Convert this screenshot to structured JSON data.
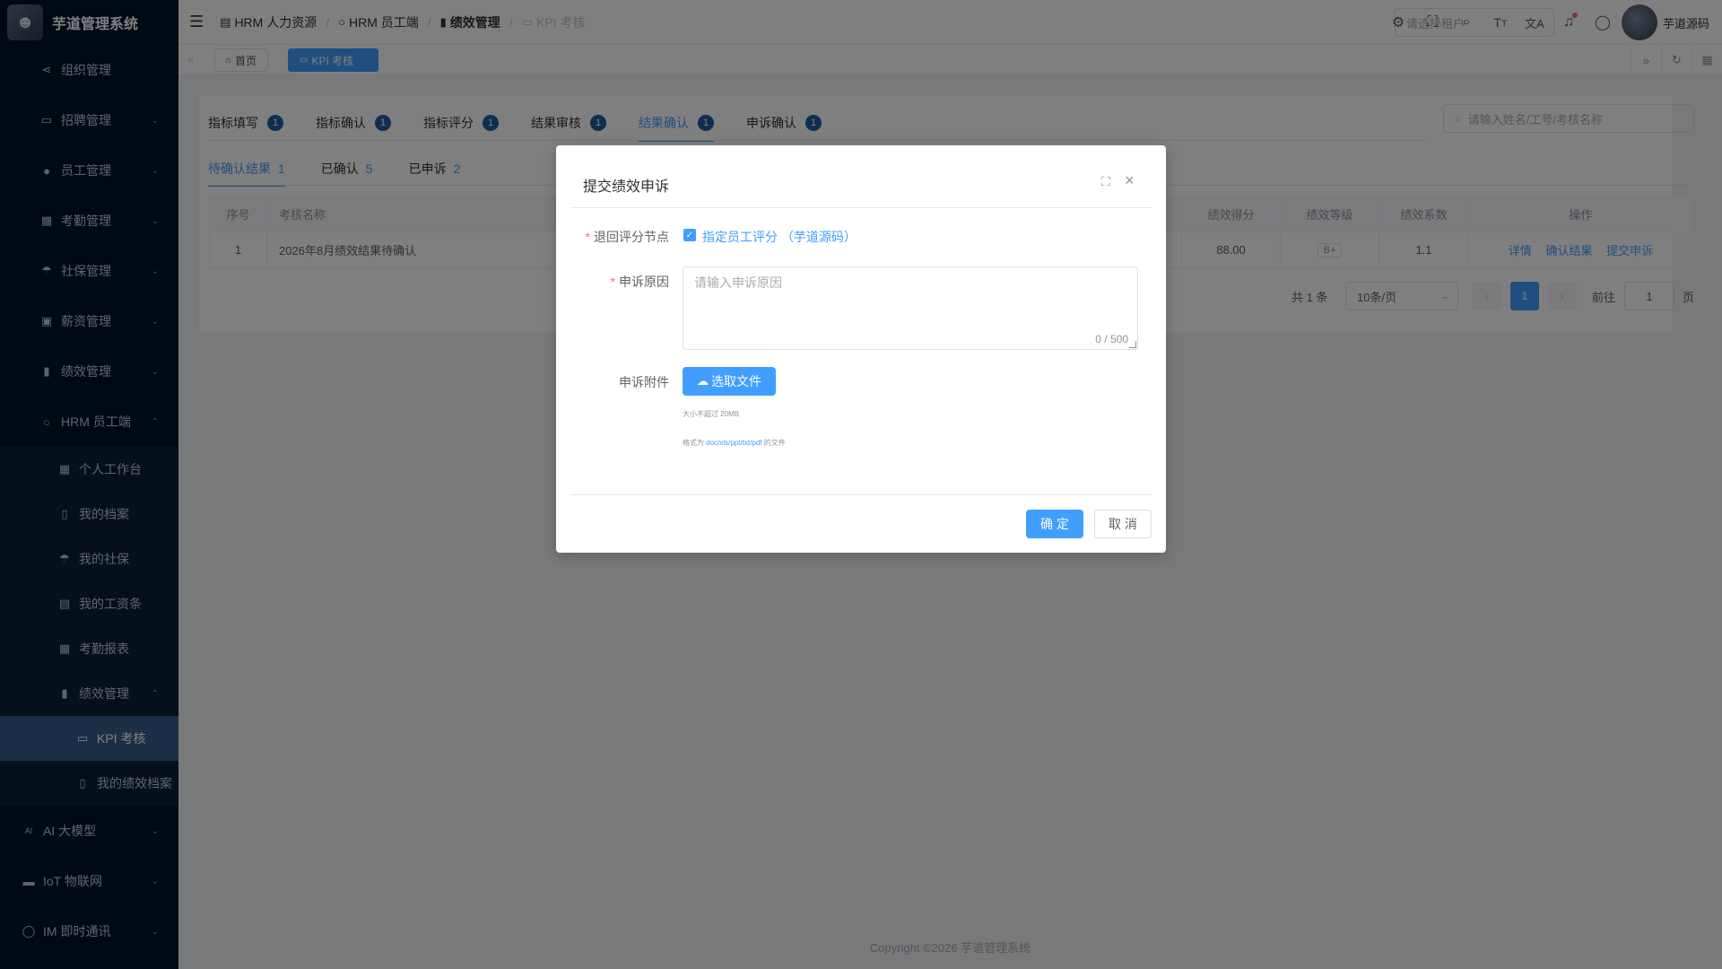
{
  "app": {
    "title": "芋道管理系统"
  },
  "sidebar": {
    "items": [
      {
        "label": "组织管理",
        "icon": "share-icon"
      },
      {
        "label": "招聘管理",
        "icon": "briefcase-icon"
      },
      {
        "label": "员工管理",
        "icon": "user-icon"
      },
      {
        "label": "考勤管理",
        "icon": "calendar-icon"
      },
      {
        "label": "社保管理",
        "icon": "umbrella-icon"
      },
      {
        "label": "薪资管理",
        "icon": "money-icon"
      },
      {
        "label": "绩效管理",
        "icon": "bar-chart-icon"
      },
      {
        "label": "HRM 员工端",
        "icon": "user-outline-icon"
      }
    ],
    "hrm_sub": [
      {
        "label": "个人工作台",
        "icon": "calendar-icon"
      },
      {
        "label": "我的档案",
        "icon": "book-icon"
      },
      {
        "label": "我的社保",
        "icon": "umbrella-icon"
      },
      {
        "label": "我的工资条",
        "icon": "document-icon"
      },
      {
        "label": "考勤报表",
        "icon": "calendar-icon"
      },
      {
        "label": "绩效管理",
        "icon": "bar-chart-icon"
      }
    ],
    "perf_sub": [
      {
        "label": "KPI 考核",
        "icon": "presentation-icon"
      },
      {
        "label": "我的绩效档案",
        "icon": "book-icon"
      }
    ],
    "bottom": [
      {
        "label": "AI 大模型",
        "icon": "ai-icon"
      },
      {
        "label": "IoT 物联网",
        "icon": "car-icon"
      },
      {
        "label": "IM 即时通讯",
        "icon": "chat-icon"
      }
    ]
  },
  "header": {
    "breadcrumb": [
      "HRM 人力资源",
      "HRM 员工端",
      "绩效管理",
      "KPI 考核"
    ],
    "tenant_placeholder": "请选择租户",
    "user_name": "芋道源码"
  },
  "tagsbar": {
    "tags": [
      "首页",
      "KPI 考核"
    ]
  },
  "tabs": [
    {
      "label": "指标填写",
      "badge": "1"
    },
    {
      "label": "指标确认",
      "badge": "1"
    },
    {
      "label": "指标评分",
      "badge": "1"
    },
    {
      "label": "结果审核",
      "badge": "1"
    },
    {
      "label": "结果确认",
      "badge": "1"
    },
    {
      "label": "申诉确认",
      "badge": "1"
    }
  ],
  "search": {
    "placeholder": "请输入姓名/工号/考核名称"
  },
  "subtabs": [
    {
      "label": "待确认结果",
      "count": "1"
    },
    {
      "label": "已确认",
      "count": "5"
    },
    {
      "label": "已申诉",
      "count": "2"
    }
  ],
  "table": {
    "headers": {
      "index": "序号",
      "name": "考核名称",
      "score": "绩效得分",
      "grade": "绩效等级",
      "coef": "绩效系数",
      "ops": "操作"
    },
    "rows": [
      {
        "index": "1",
        "name": "2026年8月绩效结果待确认",
        "score": "88.00",
        "grade": "B+",
        "coef": "1.1"
      }
    ],
    "ops": [
      "详情",
      "确认结果",
      "提交申诉"
    ]
  },
  "pager": {
    "total": "共 1 条",
    "page_size": "10条/页",
    "current": "1",
    "goto_label": "前往",
    "goto_value": "1",
    "page_suffix": "页"
  },
  "footer": "Copyright ©2026 芋道管理系统",
  "dialog": {
    "title": "提交绩效申诉",
    "node_label": "退回评分节点",
    "node_value": "指定员工评分 （芋道源码）",
    "reason_label": "申诉原因",
    "reason_placeholder": "请输入申诉原因",
    "reason_count": "0 / 500",
    "attach_label": "申诉附件",
    "upload_label": "选取文件",
    "tip_size": "大小不超过 20MB",
    "tip_format_prefix": "格式为",
    "tip_format_value": "doc/xls/ppt/txt/pdf",
    "tip_format_suffix": "的文件",
    "ok": "确 定",
    "cancel": "取 消"
  }
}
